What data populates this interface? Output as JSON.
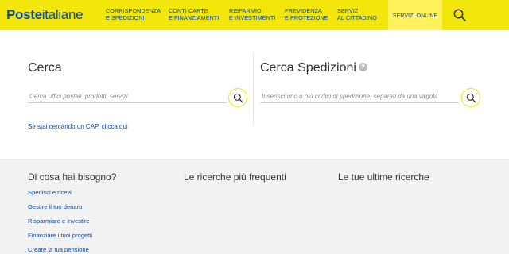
{
  "header": {
    "logo_bold": "Poste",
    "logo_rest": "italiane",
    "nav": [
      {
        "line1": "Corrispondenza",
        "line2": "e spedizioni"
      },
      {
        "line1": "Conti carte",
        "line2": "e finanziamenti"
      },
      {
        "line1": "Risparmio",
        "line2": "e investimenti"
      },
      {
        "line1": "Previdenza",
        "line2": "e protezione"
      },
      {
        "line1": "Servizi",
        "line2": "al cittadino"
      }
    ],
    "online": "Servizi Online",
    "search_icon": "search-icon"
  },
  "search": {
    "title": "Cerca",
    "placeholder": "Cerca uffici postali, prodotti, servizi",
    "value": "",
    "cap_link": "Se stai cercando un CAP, clicca qui"
  },
  "shipments": {
    "title": "Cerca Spedizioni",
    "info_icon": "?",
    "placeholder": "Inserisci uno o più codici di spedizione, separati da una virgola",
    "value": ""
  },
  "bottom": {
    "col1_title": "Di cosa hai bisogno?",
    "col2_title": "Le ricerche più frequenti",
    "col3_title": "Le tue ultime ricerche",
    "links": [
      "Spedisci e ricevi",
      "Gestire il tuo denaro",
      "Risparmiare e investire",
      "Finanziare i tuoi progetti",
      "Creare la tua pensione"
    ]
  },
  "colors": {
    "brand_yellow": "#f2e60b",
    "brand_blue": "#0a4aa0"
  }
}
